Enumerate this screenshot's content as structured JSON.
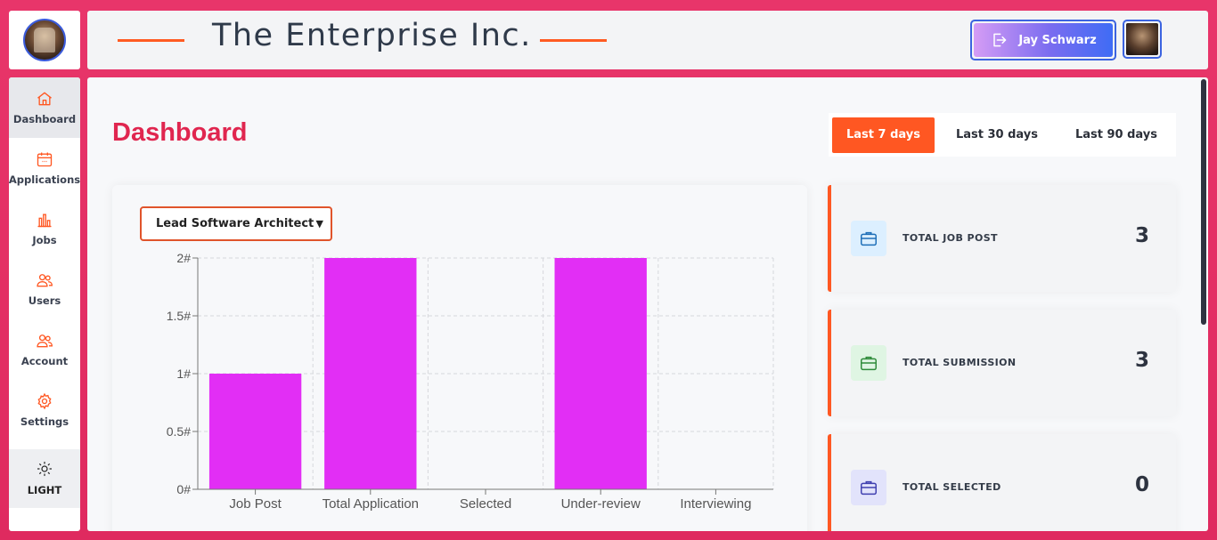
{
  "header": {
    "title": "The Enterprise Inc.",
    "user_name": "Jay Schwarz"
  },
  "sidebar": {
    "items": [
      {
        "label": "Dashboard",
        "icon": "home-icon"
      },
      {
        "label": "Applications",
        "icon": "calendar-icon"
      },
      {
        "label": "Jobs",
        "icon": "bar-chart-icon"
      },
      {
        "label": "Users",
        "icon": "users-icon"
      },
      {
        "label": "Account",
        "icon": "users-icon"
      },
      {
        "label": "Settings",
        "icon": "gear-icon"
      }
    ],
    "theme_label": "LIGHT"
  },
  "page": {
    "title": "Dashboard"
  },
  "range_tabs": [
    "Last 7 days",
    "Last 30 days",
    "Last 90 days"
  ],
  "job_select": {
    "selected": "Lead Software Architect"
  },
  "stats": [
    {
      "label": "TOTAL JOB POST",
      "value": "3",
      "icon_color": "#1e6fb8",
      "icon_bg": "#dcefff"
    },
    {
      "label": "TOTAL SUBMISSION",
      "value": "3",
      "icon_color": "#2e8b3a",
      "icon_bg": "#dff5e3"
    },
    {
      "label": "TOTAL SELECTED",
      "value": "0",
      "icon_color": "#3f3fb0",
      "icon_bg": "#e2e3fb"
    }
  ],
  "colors": {
    "accent": "#ff5722",
    "title": "#e0264f",
    "bar": "#e22ef5",
    "background": "#e8356a"
  },
  "chart_data": {
    "type": "bar",
    "categories": [
      "Job Post",
      "Total Application",
      "Selected",
      "Under-review",
      "Interviewing"
    ],
    "values": [
      1,
      2,
      0,
      2,
      0
    ],
    "ylim": [
      0,
      2
    ],
    "yticks": [
      "0#",
      "0.5#",
      "1#",
      "1.5#",
      "2#"
    ],
    "ytick_values": [
      0,
      0.5,
      1,
      1.5,
      2
    ],
    "grid": true,
    "grid_style": "dashed"
  }
}
